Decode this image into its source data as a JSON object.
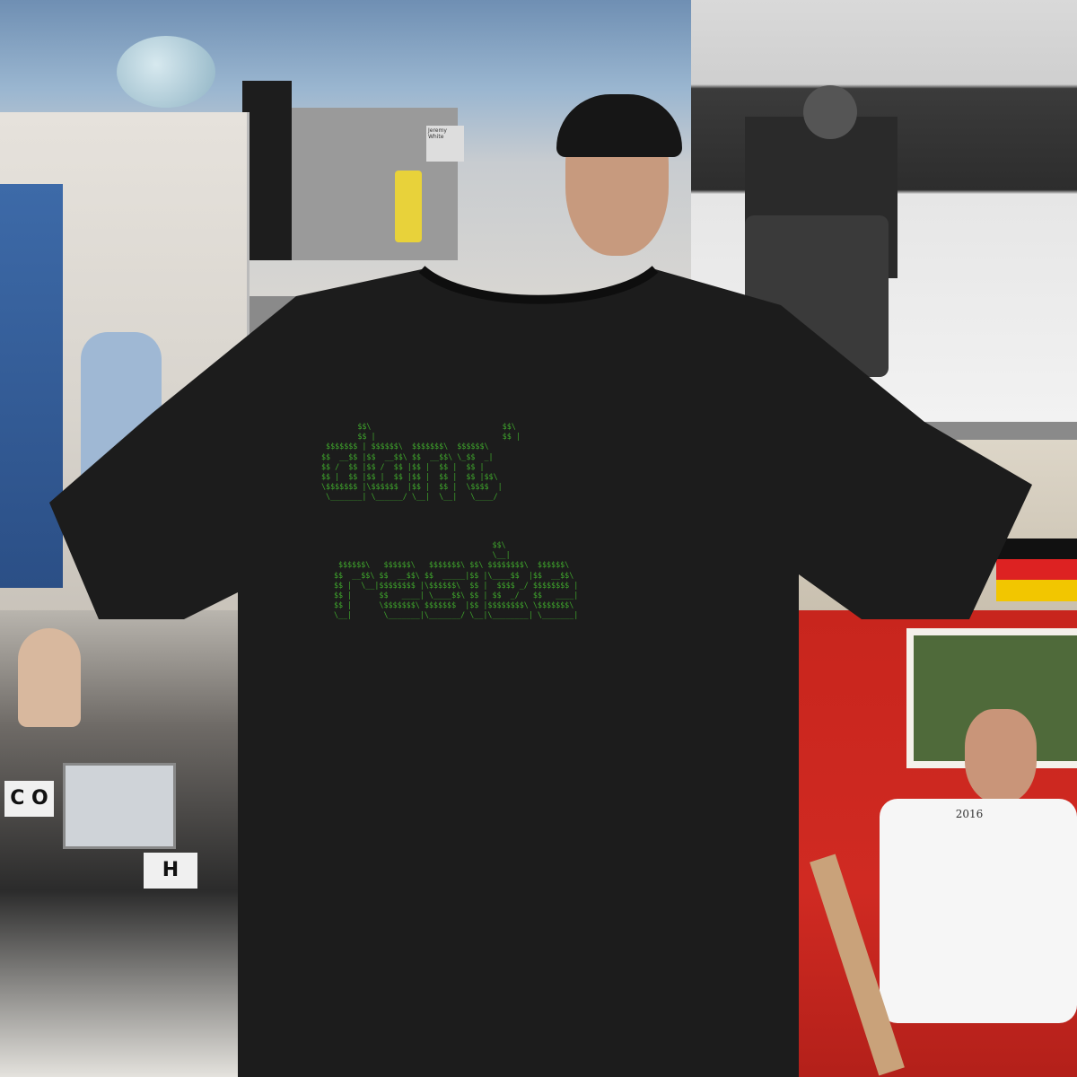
{
  "shirt": {
    "color": "#1c1c1c",
    "print_color": "#3fa52c",
    "ascii_line1": "        $$\\                             $$\\     \n        $$ |                            $$ |    \n $$$$$$$ | $$$$$$\\  $$$$$$$\\  $$$$$$\\   \n$$  __$$ |$$  __$$\\ $$  __$$\\ \\_$$  _|  \n$$ /  $$ |$$ /  $$ |$$ |  $$ |  $$ |    \n$$ |  $$ |$$ |  $$ |$$ |  $$ |  $$ |$$\\ \n\\$$$$$$$ |\\$$$$$$  |$$ |  $$ |  \\$$$$  |\n \\_______| \\______/ \\__|  \\__|   \\____/ ",
    "ascii_line2": "                                   $$\\                               \n                                   \\__|                              \n $$$$$$\\   $$$$$$\\   $$$$$$$\\ $$\\ $$$$$$$$\\  $$$$$$\\  \n$$  __$$\\ $$  __$$\\ $$  _____|$$ |\\____$$  |$$  __$$\\ \n$$ |  \\__|$$$$$$$$ |\\$$$$$$\\  $$ |  $$$$ _/ $$$$$$$$ |\n$$ |      $$   ____| \\____$$\\ $$ | $$  _/   $$   ____|\n$$ |      \\$$$$$$$\\ $$$$$$$  |$$ |$$$$$$$$\\ \\$$$$$$$\\ \n\\__|       \\_______|\\_______/ \\__|\\________| \\_______|"
  },
  "photo_labels": {
    "cube_nameplate": "Jeremy White",
    "laptop_sign": "C O",
    "sign_letter": "H",
    "tshirt_text": "2016"
  },
  "background_photos": [
    "office-window-desk",
    "office-monitors-cutout",
    "mural-wall",
    "newsroom-desk",
    "flags-shelf",
    "red-wall-cutout"
  ]
}
